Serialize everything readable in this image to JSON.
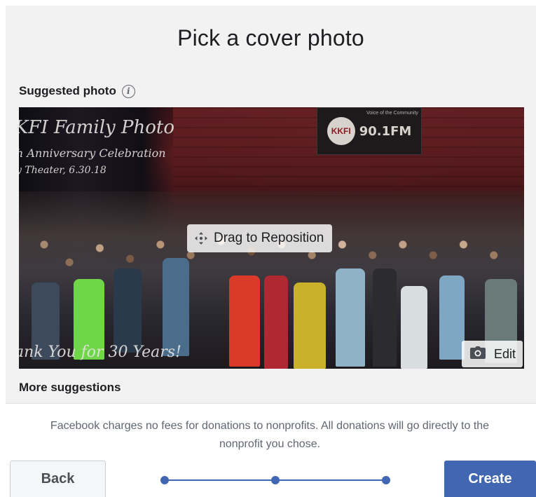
{
  "dialog": {
    "title": "Pick a cover photo",
    "suggested_label": "Suggested photo",
    "more_suggestions_label": "More suggestions"
  },
  "photo": {
    "script_title": "KFI Family Photo",
    "script_subtitle": "h Anniversary Celebration",
    "script_venue": "y Theater, 6.30.18",
    "script_thanks": "ank You for 30 Years!",
    "banner_logo": "KKFI",
    "banner_text": "90.1FM",
    "banner_tagline": "Voice of the Community",
    "drag_label": "Drag to Reposition",
    "edit_label": "Edit"
  },
  "footer": {
    "disclaimer": "Facebook charges no fees for donations to nonprofits. All donations will go directly to the nonprofit you chose.",
    "back_label": "Back",
    "create_label": "Create",
    "steps_total": 3,
    "steps_done": 3
  },
  "colors": {
    "accent": "#4267b2",
    "panel_bg": "#f2f2f2",
    "muted_text": "#606770"
  }
}
